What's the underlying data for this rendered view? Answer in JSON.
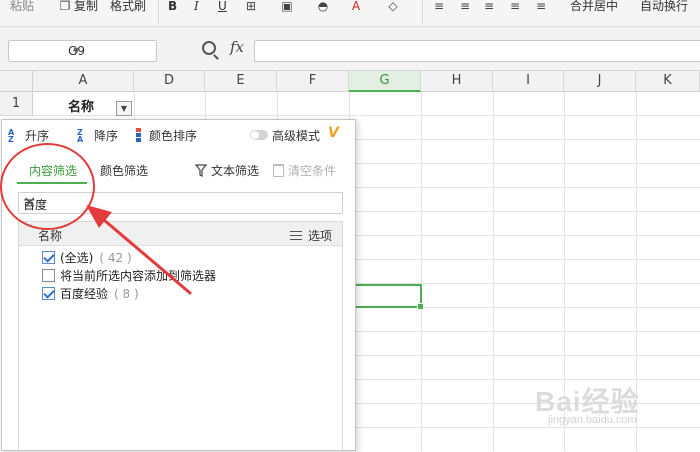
{
  "ribbon": {
    "paste_label": "粘贴",
    "copy_label": "复制",
    "format_painter_label": "格式刷",
    "bold": "B",
    "italic": "I",
    "underline": "U",
    "font_color": "A",
    "merge_center_label": "合并居中",
    "wrap_text_label": "自动换行"
  },
  "formula_bar": {
    "cell_ref": "G9",
    "fx_label": "fx",
    "formula_value": ""
  },
  "grid": {
    "columns": [
      "A",
      "D",
      "E",
      "F",
      "G",
      "H",
      "I",
      "J",
      "K"
    ],
    "selected_column": "G",
    "rows": [
      "1"
    ],
    "a1_value": "名称"
  },
  "filter_panel": {
    "sort_asc_label": "升序",
    "sort_desc_label": "降序",
    "color_sort_label": "颜色排序",
    "advanced_mode_label": "高级模式",
    "advanced_mode_badge": "V",
    "tabs": [
      {
        "label": "内容筛选",
        "active": true
      },
      {
        "label": "颜色筛选",
        "active": false
      }
    ],
    "text_filter_label": "文本筛选",
    "clear_condition_label": "清空条件",
    "search_value": "百度",
    "list_header": "名称",
    "options_label": "选项",
    "items": [
      {
        "label": "(全选)",
        "count": "( 42 )",
        "checked": true
      },
      {
        "label": "将当前所选内容添加到筛选器",
        "count": "",
        "checked": false
      },
      {
        "label": "百度经验",
        "count": "( 8 )",
        "checked": true
      }
    ]
  },
  "watermark": {
    "brand": "Bai经验",
    "url": "jingyan.baidu.com"
  },
  "colors": {
    "accent_green": "#4caf50",
    "annotation_red": "#e33b3b",
    "checkbox_blue": "#2f6fd0"
  }
}
